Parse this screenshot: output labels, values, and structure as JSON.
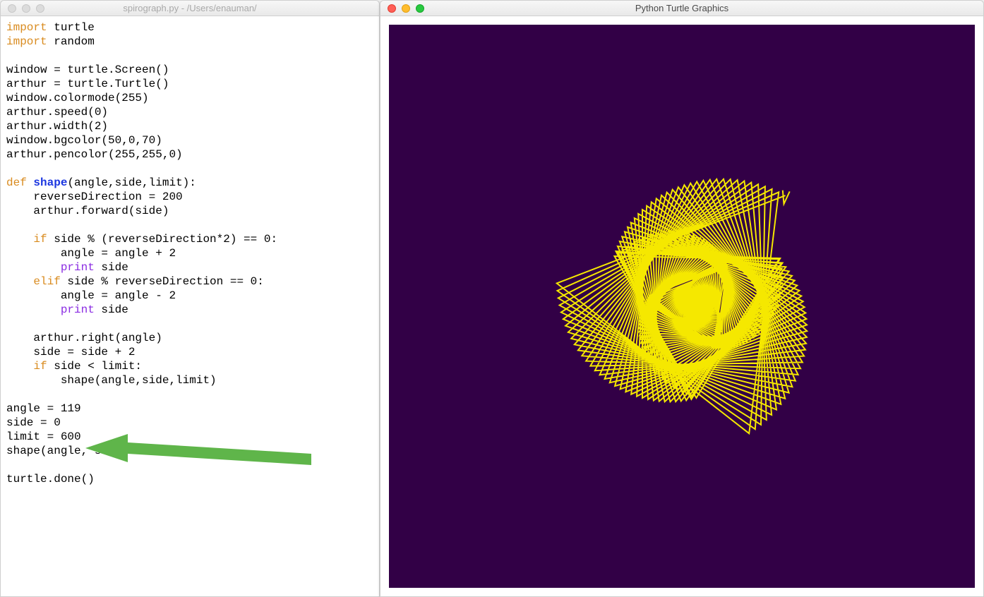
{
  "editor": {
    "title": "spirograph.py - /Users/enauman/",
    "code_tokens": [
      {
        "t": "import",
        "c": "kw-orange"
      },
      {
        "t": " turtle\n"
      },
      {
        "t": "import",
        "c": "kw-orange"
      },
      {
        "t": " random\n"
      },
      {
        "t": "\n"
      },
      {
        "t": "window = turtle.Screen()\n"
      },
      {
        "t": "arthur = turtle.Turtle()\n"
      },
      {
        "t": "window.colormode(255)\n"
      },
      {
        "t": "arthur.speed(0)\n"
      },
      {
        "t": "arthur.width(2)\n"
      },
      {
        "t": "window.bgcolor(50,0,70)\n"
      },
      {
        "t": "arthur.pencolor(255,255,0)\n"
      },
      {
        "t": "\n"
      },
      {
        "t": "def",
        "c": "kw-orange"
      },
      {
        "t": " "
      },
      {
        "t": "shape",
        "c": "kw-blue"
      },
      {
        "t": "(angle,side,limit):\n"
      },
      {
        "t": "    reverseDirection = 200\n"
      },
      {
        "t": "    arthur.forward(side)\n"
      },
      {
        "t": "\n"
      },
      {
        "t": "    "
      },
      {
        "t": "if",
        "c": "kw-orange"
      },
      {
        "t": " side % (reverseDirection*2) == 0:\n"
      },
      {
        "t": "        angle = angle + 2\n"
      },
      {
        "t": "        "
      },
      {
        "t": "print",
        "c": "kw-purple"
      },
      {
        "t": " side\n"
      },
      {
        "t": "    "
      },
      {
        "t": "elif",
        "c": "kw-orange"
      },
      {
        "t": " side % reverseDirection == 0:\n"
      },
      {
        "t": "        angle = angle - 2\n"
      },
      {
        "t": "        "
      },
      {
        "t": "print",
        "c": "kw-purple"
      },
      {
        "t": " side\n"
      },
      {
        "t": "\n"
      },
      {
        "t": "    arthur.right(angle)\n"
      },
      {
        "t": "    side = side + 2\n"
      },
      {
        "t": "    "
      },
      {
        "t": "if",
        "c": "kw-orange"
      },
      {
        "t": " side < limit:\n"
      },
      {
        "t": "        shape(angle,side,limit)\n"
      },
      {
        "t": "\n"
      },
      {
        "t": "angle = 119\n"
      },
      {
        "t": "side = 0\n"
      },
      {
        "t": "limit = 600\n"
      },
      {
        "t": "shape(angle, side, limit)\n"
      },
      {
        "t": "\n"
      },
      {
        "t": "turtle.done()\n"
      }
    ]
  },
  "turtle": {
    "title": "Python Turtle Graphics",
    "bgcolor": "#320046",
    "pencolor": "#f5e800",
    "params": {
      "angle": 119,
      "side": 0,
      "limit": 600,
      "reverseDirection": 200,
      "sideStep": 2,
      "penwidth": 2
    }
  },
  "annotation": {
    "arrow_color": "#5fb54a"
  }
}
